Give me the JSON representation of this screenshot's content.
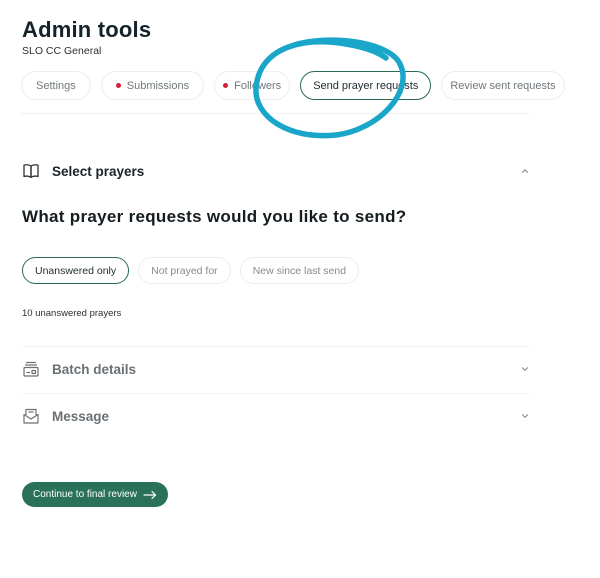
{
  "header": {
    "title": "Admin tools",
    "subtitle": "SLO CC General"
  },
  "tabs": [
    {
      "label": "Settings",
      "dot": false,
      "active": false
    },
    {
      "label": "Submissions",
      "dot": true,
      "active": false
    },
    {
      "label": "Followers",
      "dot": true,
      "active": false
    },
    {
      "label": "Send prayer requests",
      "dot": false,
      "active": true
    },
    {
      "label": "Review sent requests",
      "dot": false,
      "active": false
    }
  ],
  "select_section": {
    "title": "Select prayers",
    "icon": "book-open-icon",
    "expanded": true
  },
  "question": "What prayer requests would you like to send?",
  "filters": [
    {
      "label": "Unanswered only",
      "active": true
    },
    {
      "label": "Not prayed for",
      "active": false
    },
    {
      "label": "New since last send",
      "active": false
    }
  ],
  "count_text": "10 unanswered prayers",
  "batch_section": {
    "title": "Batch details",
    "icon": "batch-tray-icon",
    "expanded": false
  },
  "message_section": {
    "title": "Message",
    "icon": "message-envelope-icon",
    "expanded": false
  },
  "cta": {
    "label": "Continue to final review",
    "icon": "arrow-right-icon"
  },
  "colors": {
    "accent": "#2a7159",
    "active_border": "#2a6a56",
    "notification_dot": "#d62235",
    "annotation": "#1aa6c8"
  }
}
